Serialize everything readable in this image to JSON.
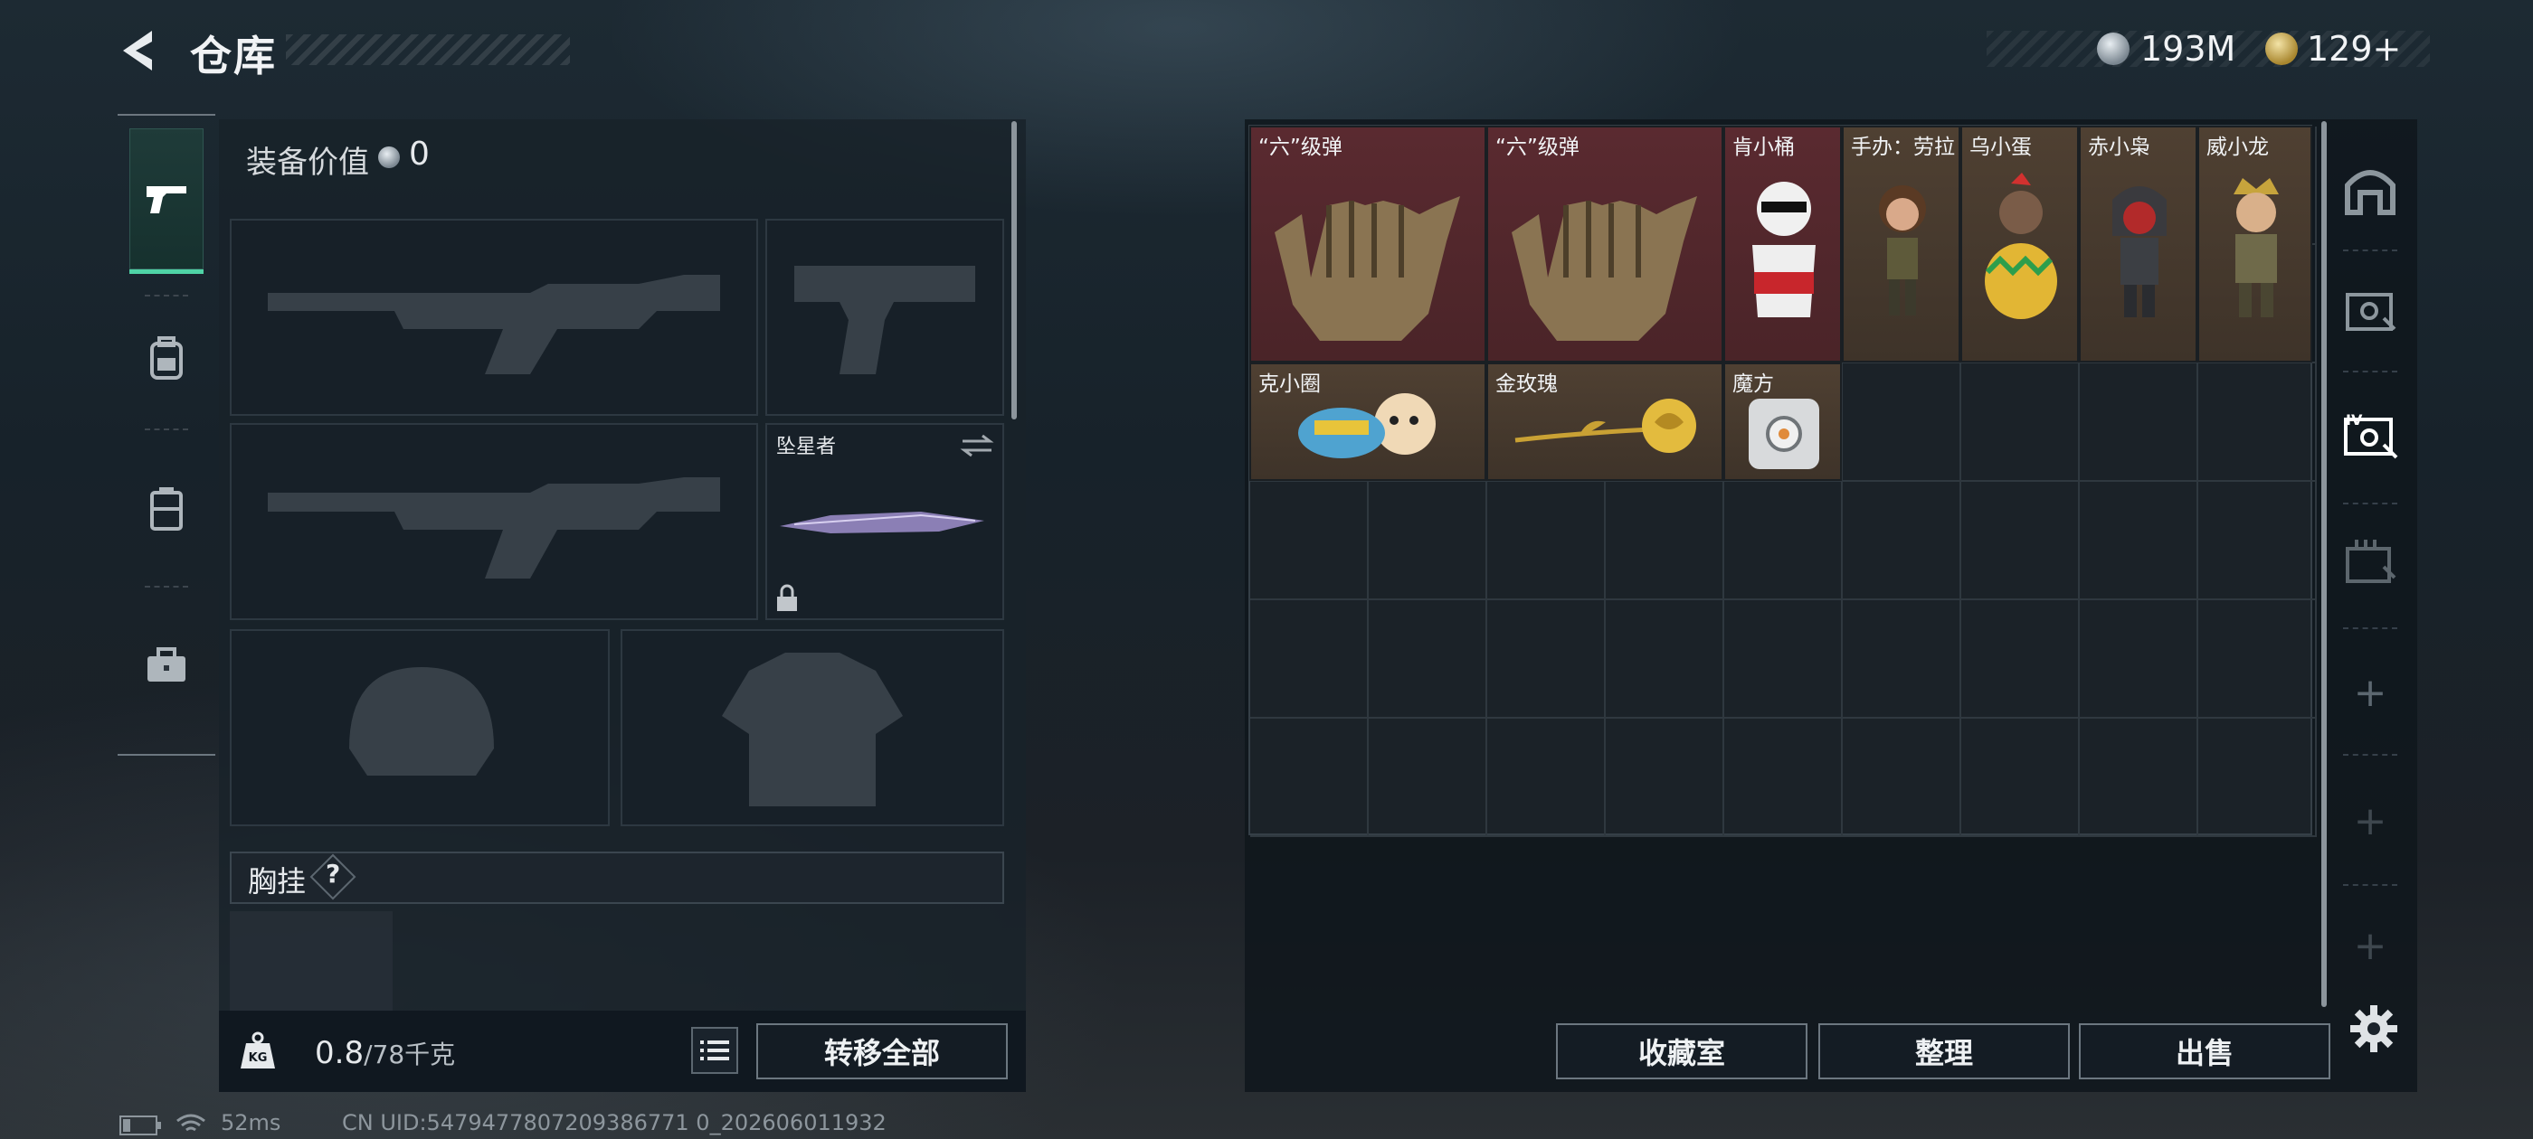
{
  "header": {
    "title": "仓库",
    "currencies": [
      {
        "icon": "silver-coin-icon",
        "value": "193M"
      },
      {
        "icon": "gold-coin-icon",
        "value": "129+"
      }
    ]
  },
  "left_tabs": [
    {
      "icon": "pistol-icon",
      "active": true
    },
    {
      "icon": "backpack-icon",
      "active": false
    },
    {
      "icon": "vest-icon",
      "active": false
    },
    {
      "icon": "toolbox-icon",
      "active": false
    }
  ],
  "equipment": {
    "value_label": "装备价值",
    "value": "0",
    "melee_name": "坠星者",
    "chest_rig_label": "胸挂",
    "chest_rig_help": "?"
  },
  "footer_left": {
    "weight_current": "0.8",
    "weight_max": "/78千克",
    "transfer_all": "转移全部"
  },
  "inventory": {
    "items": [
      {
        "name": "“六”级弹",
        "color": "red"
      },
      {
        "name": "“六”级弹",
        "color": "red"
      },
      {
        "name": "肯小桶",
        "color": "red"
      },
      {
        "name": "手办：劳拉",
        "color": "brown"
      },
      {
        "name": "乌小蛋",
        "color": "brown"
      },
      {
        "name": "赤小枭",
        "color": "brown"
      },
      {
        "name": "威小龙",
        "color": "brown"
      },
      {
        "name": "克小圈",
        "color": "brown"
      },
      {
        "name": "金玫瑰",
        "color": "brown"
      },
      {
        "name": "魔方",
        "color": "brown"
      }
    ]
  },
  "bottom_buttons": {
    "collection": "收藏室",
    "organize": "整理",
    "sell": "出售"
  },
  "right_tabs": [
    {
      "icon": "shelter-icon"
    },
    {
      "icon": "storage-1-icon"
    },
    {
      "icon": "storage-4-icon"
    },
    {
      "icon": "storage-extra-icon"
    },
    {
      "icon": "add-icon",
      "label": "+"
    },
    {
      "icon": "add-icon",
      "label": "+"
    },
    {
      "icon": "add-icon",
      "label": "+"
    }
  ],
  "status_bar": {
    "ping": "52ms",
    "uid": "CN UID:5479477807209386771 0_202606011932"
  },
  "colors": {
    "accent_green": "#4fd3a6",
    "item_red": "#5a2a30",
    "item_brown": "#4f4032"
  }
}
